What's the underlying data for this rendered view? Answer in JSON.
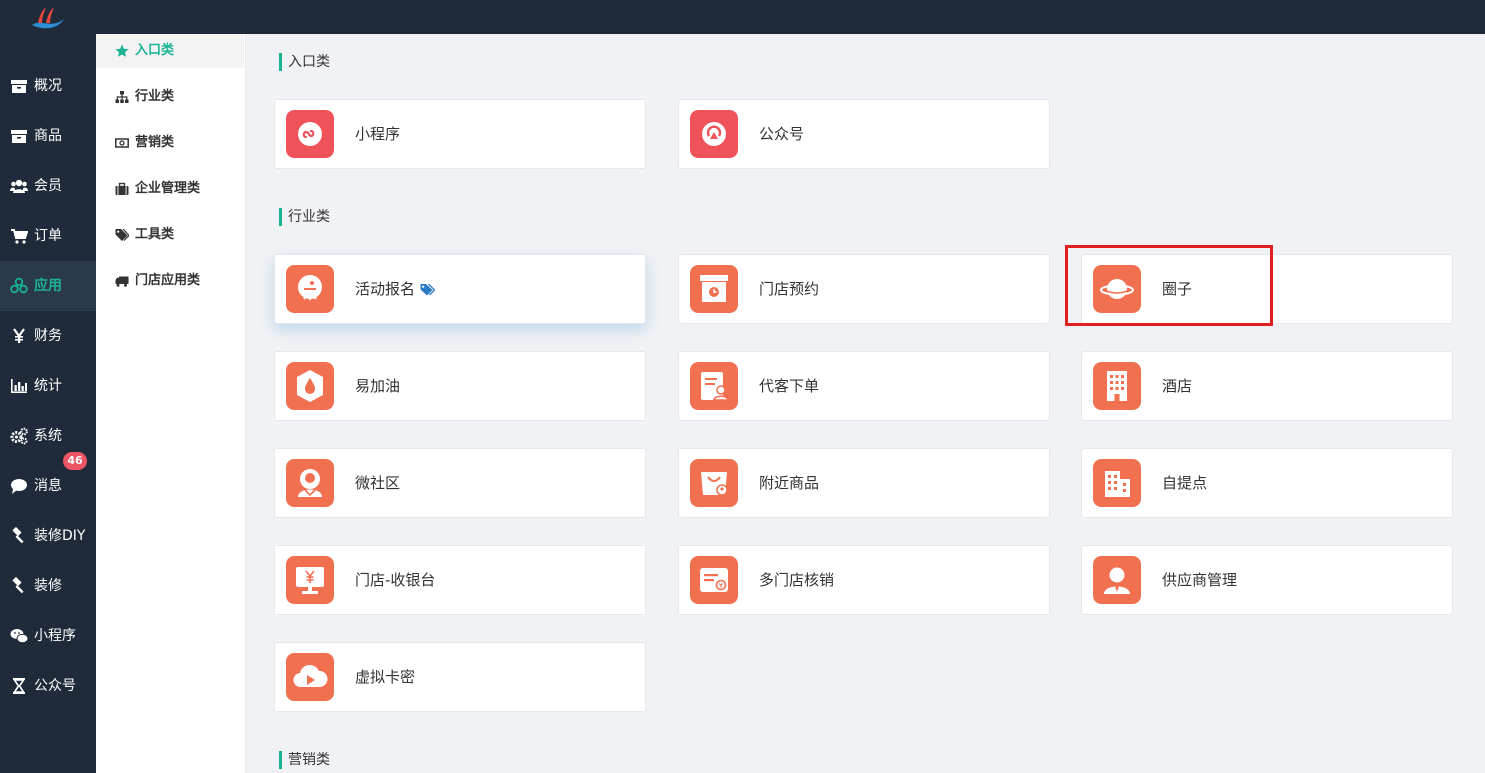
{
  "nav": {
    "items": [
      {
        "label": "概况",
        "icon": "archive-icon"
      },
      {
        "label": "商品",
        "icon": "archive-icon"
      },
      {
        "label": "会员",
        "icon": "users-icon"
      },
      {
        "label": "订单",
        "icon": "cart-icon"
      },
      {
        "label": "应用",
        "icon": "cubes-icon",
        "active": true
      },
      {
        "label": "财务",
        "icon": "yen-icon"
      },
      {
        "label": "统计",
        "icon": "bar-chart-icon"
      },
      {
        "label": "系统",
        "icon": "gears-icon"
      },
      {
        "label": "消息",
        "icon": "comment-icon",
        "badge": "46"
      },
      {
        "label": "装修DIY",
        "icon": "gavel-icon"
      },
      {
        "label": "装修",
        "icon": "gavel-icon"
      },
      {
        "label": "小程序",
        "icon": "wechat-icon"
      },
      {
        "label": "公众号",
        "icon": "hourglass-icon"
      }
    ]
  },
  "subnav": {
    "items": [
      {
        "label": "入口类",
        "icon": "star-icon",
        "active": true
      },
      {
        "label": "行业类",
        "icon": "sitemap-icon"
      },
      {
        "label": "营销类",
        "icon": "money-icon"
      },
      {
        "label": "企业管理类",
        "icon": "briefcase-icon"
      },
      {
        "label": "工具类",
        "icon": "tags-icon"
      },
      {
        "label": "门店应用类",
        "icon": "truck-icon"
      }
    ]
  },
  "sections": {
    "entry": {
      "title": "入口类",
      "cards": [
        {
          "label": "小程序",
          "icon": "mini-program-icon",
          "color": "#f0525a"
        },
        {
          "label": "公众号",
          "icon": "official-account-icon",
          "color": "#f0525a"
        }
      ]
    },
    "industry": {
      "title": "行业类",
      "cards": [
        {
          "label": "活动报名",
          "icon": "event-signup-icon",
          "color": "#f07050",
          "tag": "tag-icon"
        },
        {
          "label": "门店预约",
          "icon": "store-booking-icon",
          "color": "#f07050"
        },
        {
          "label": "圈子",
          "icon": "planet-icon",
          "color": "#f07050"
        },
        {
          "label": "易加油",
          "icon": "fuel-drop-icon",
          "color": "#f07050"
        },
        {
          "label": "代客下单",
          "icon": "proxy-order-icon",
          "color": "#f07050"
        },
        {
          "label": "酒店",
          "icon": "hotel-icon",
          "color": "#f07050"
        },
        {
          "label": "微社区",
          "icon": "community-icon",
          "color": "#f07050"
        },
        {
          "label": "附近商品",
          "icon": "nearby-goods-icon",
          "color": "#f07050"
        },
        {
          "label": "自提点",
          "icon": "pickup-building-icon",
          "color": "#f07050"
        },
        {
          "label": "门店-收银台",
          "icon": "cashier-monitor-icon",
          "color": "#f07050"
        },
        {
          "label": "多门店核销",
          "icon": "verify-ticket-icon",
          "color": "#f07050"
        },
        {
          "label": "供应商管理",
          "icon": "supplier-user-icon",
          "color": "#f07050"
        },
        {
          "label": "虚拟卡密",
          "icon": "cloud-play-icon",
          "color": "#f07050"
        }
      ]
    },
    "marketing": {
      "title": "营销类"
    }
  },
  "colors": {
    "accent": "#1ab394",
    "sidebar_bg": "#1f2b3a",
    "highlight_box": "#e02020",
    "badge_bg": "#ed5565",
    "tag_blue": "#2b7cc7"
  }
}
